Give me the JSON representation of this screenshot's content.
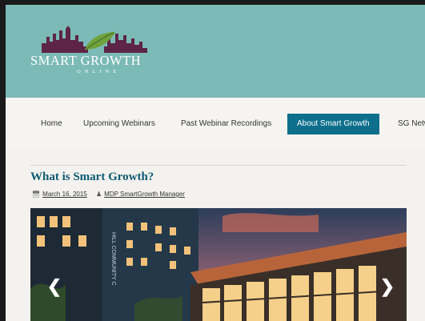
{
  "header": {
    "logo": {
      "title": "SMART GROWTH",
      "subtitle": "ONLINE"
    },
    "colors": {
      "band": "#7bbab6",
      "skyline": "#5e2448",
      "leaf": "#6fa23d"
    }
  },
  "nav": {
    "items": [
      {
        "label": "Home"
      },
      {
        "label": "Upcoming Webinars"
      },
      {
        "label": "Past Webinar Recordings"
      },
      {
        "label": "About Smart Growth",
        "active": true
      },
      {
        "label": "SG Netw"
      }
    ],
    "active_color": "#0d6f8c"
  },
  "post": {
    "title": "What is Smart Growth?",
    "date": "March 16, 2015",
    "author": "MDP SmartGrowth Manager",
    "date_icon": "calendar-icon",
    "author_icon": "user-icon",
    "title_color": "#0d5a72"
  },
  "slider": {
    "building_sign": "HILL COMMUNITY C",
    "prev_icon": "chevron-left-icon",
    "next_icon": "chevron-right-icon",
    "prev_glyph": "❮",
    "next_glyph": "❯"
  }
}
